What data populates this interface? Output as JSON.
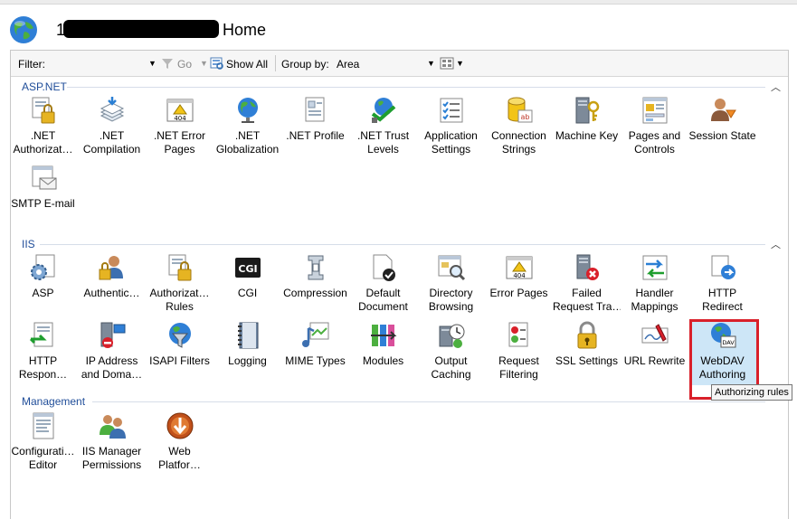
{
  "header": {
    "title_lead": "1",
    "title": "Home"
  },
  "filterbar": {
    "filter_label": "Filter:",
    "go_label": "Go",
    "show_all_label": "Show All",
    "group_by_label": "Group by:",
    "group_by_value": "Area"
  },
  "sections": {
    "aspnet": "ASP.NET",
    "iis": "IIS",
    "management": "Management"
  },
  "tiles": {
    "net_authorization": ".NET\nAuthorizat…",
    "net_compilation": ".NET\nCompilation",
    "net_error_pages": ".NET Error\nPages",
    "net_globalization": ".NET\nGlobalization",
    "net_profile": ".NET Profile",
    "net_trust_levels": ".NET Trust\nLevels",
    "application_settings": "Application\nSettings",
    "connection_strings": "Connection\nStrings",
    "machine_key": "Machine Key",
    "pages_and_controls": "Pages and\nControls",
    "session_state": "Session State",
    "smtp_email": "SMTP E-mail",
    "asp": "ASP",
    "authentication": "Authentic…",
    "authorization_rules": "Authorizat…\nRules",
    "cgi": "CGI",
    "compression": "Compression",
    "default_document": "Default\nDocument",
    "directory_browsing": "Directory\nBrowsing",
    "error_pages": "Error Pages",
    "failed_request": "Failed\nRequest Tra…",
    "handler_mappings": "Handler\nMappings",
    "http_redirect": "HTTP\nRedirect",
    "http_response": "HTTP\nRespon…",
    "ip_address": "IP Address\nand Doma…",
    "isapi_filters": "ISAPI Filters",
    "logging": "Logging",
    "mime_types": "MIME Types",
    "modules": "Modules",
    "output_caching": "Output\nCaching",
    "request_filtering": "Request\nFiltering",
    "ssl_settings": "SSL Settings",
    "url_rewrite": "URL Rewrite",
    "webdav_authoring": "WebDAV\nAuthoring",
    "configuration_editor": "Configurati…\nEditor",
    "iis_manager_permissions": "IIS Manager\nPermissions",
    "web_platform": "Web\nPlatfor…"
  },
  "cgi_icon_text": "CGI",
  "error_icon_text": "404",
  "tooltip": "Authorizing rules",
  "colors": {
    "section_header": "#1f4d99",
    "highlight_border": "#d9202a",
    "selection": "#cde6f7"
  }
}
